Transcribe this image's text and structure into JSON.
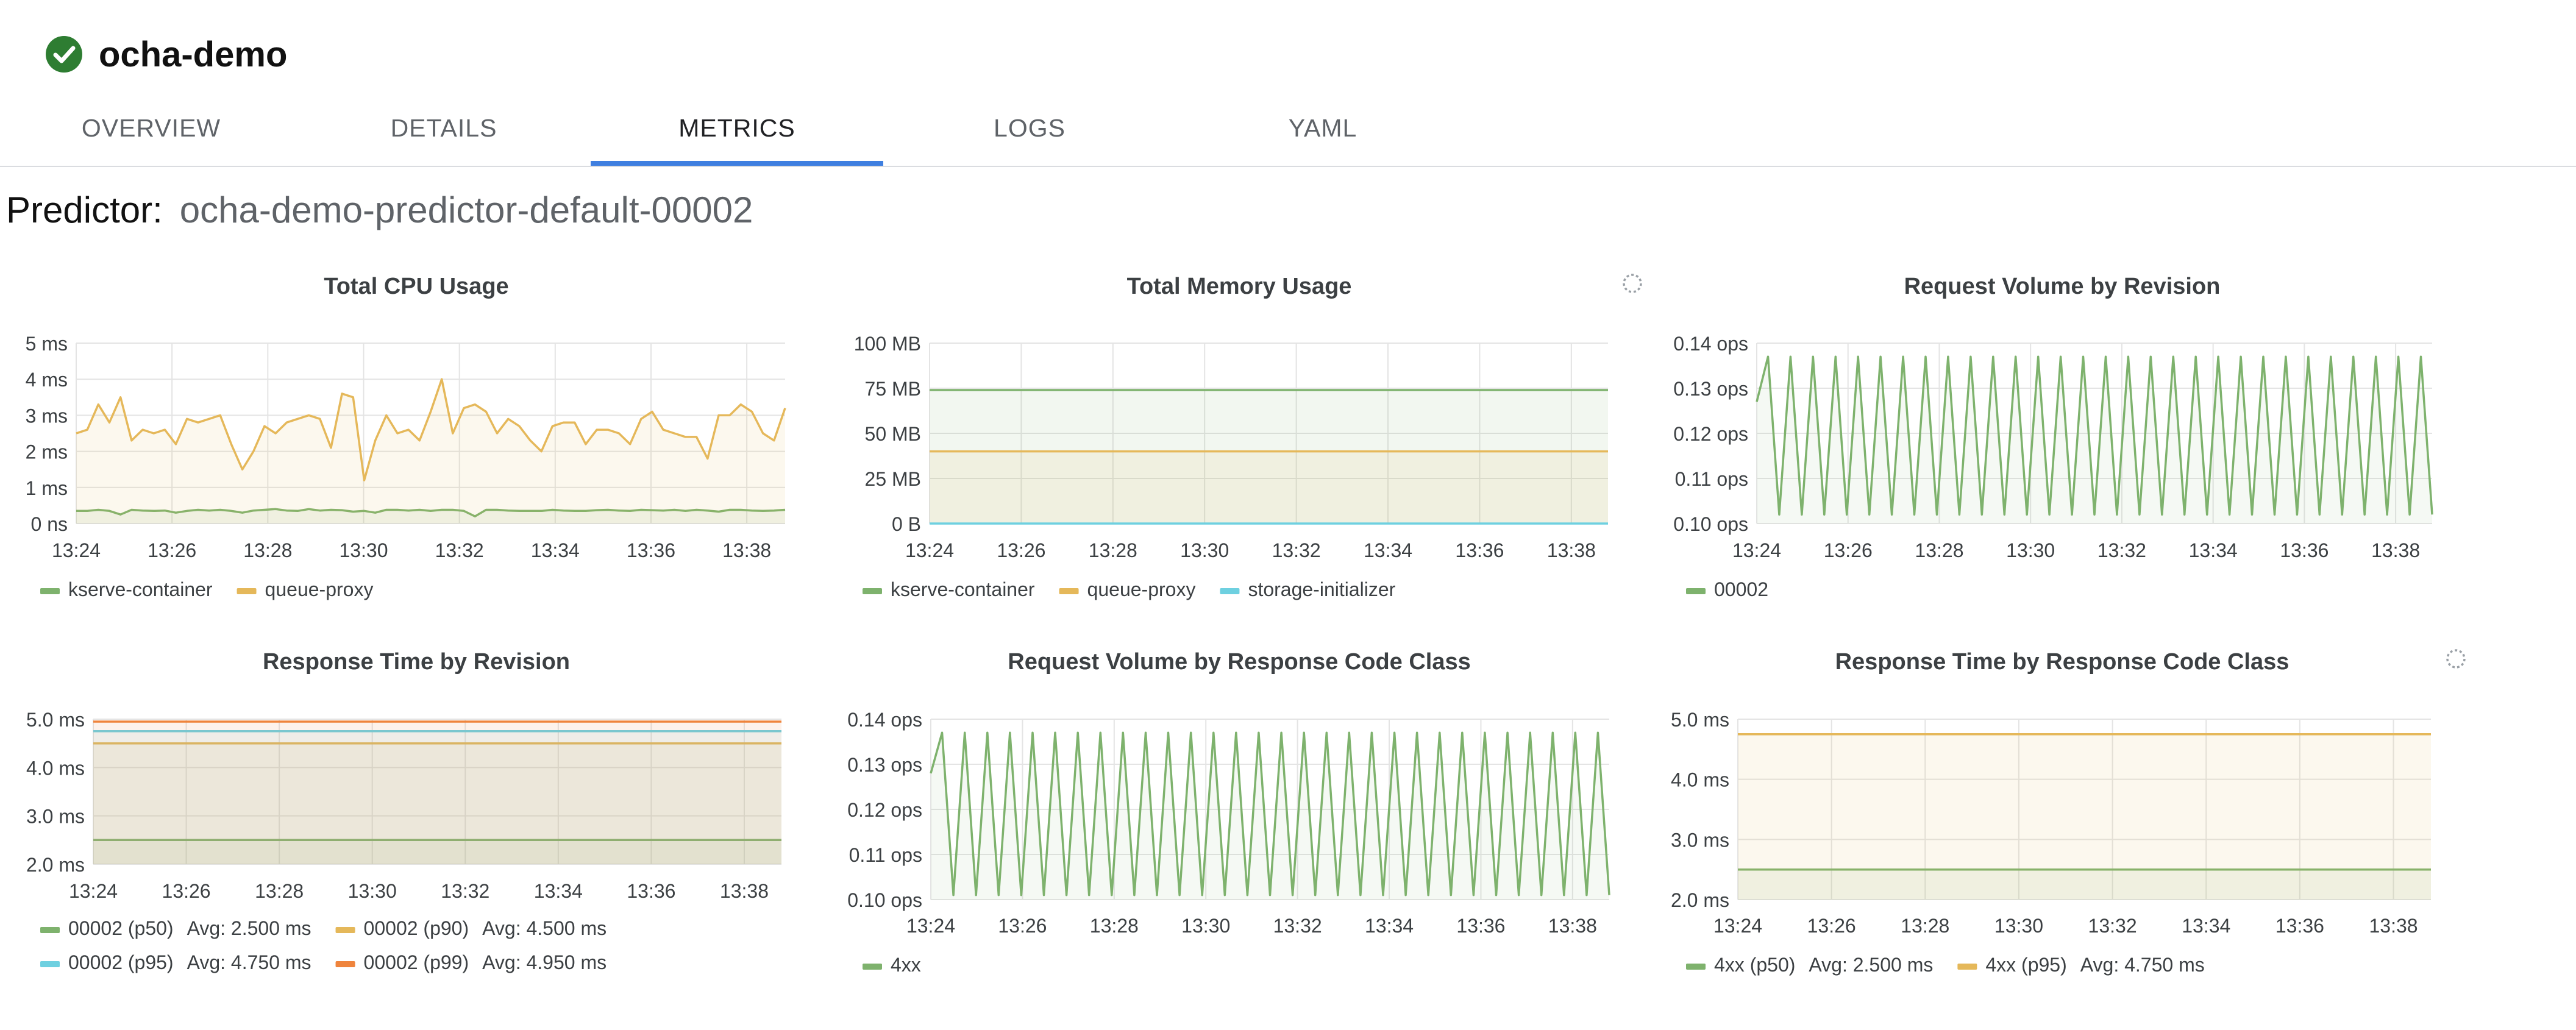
{
  "header": {
    "title": "ocha-demo",
    "status_icon": "check-circle-icon",
    "status_color": "#2e7d32"
  },
  "tabs": [
    {
      "label": "OVERVIEW",
      "active": false
    },
    {
      "label": "DETAILS",
      "active": false
    },
    {
      "label": "METRICS",
      "active": true
    },
    {
      "label": "LOGS",
      "active": false
    },
    {
      "label": "YAML",
      "active": false
    }
  ],
  "predictor": {
    "label": "Predictor:",
    "name": "ocha-demo-predictor-default-00002"
  },
  "colors": {
    "green": "#7eb26d",
    "yellow": "#e5b85a",
    "cyan": "#6ed0e0",
    "orange": "#ef843c",
    "accent": "#3f7fe0"
  },
  "chart_data": [
    {
      "type": "area",
      "title": "Total CPU Usage",
      "x": [
        "13:24",
        "13:26",
        "13:28",
        "13:30",
        "13:32",
        "13:34",
        "13:36",
        "13:38"
      ],
      "y_ticks": [
        "0 ns",
        "1 ms",
        "2 ms",
        "3 ms",
        "4 ms",
        "5 ms"
      ],
      "ylim": [
        0,
        5
      ],
      "xlim": [
        0,
        14.8
      ],
      "series": [
        {
          "name": "kserve-container",
          "color": "#7eb26d",
          "values": [
            0.35,
            0.35,
            0.38,
            0.35,
            0.25,
            0.38,
            0.36,
            0.35,
            0.36,
            0.3,
            0.35,
            0.38,
            0.36,
            0.38,
            0.35,
            0.3,
            0.36,
            0.38,
            0.4,
            0.36,
            0.35,
            0.4,
            0.36,
            0.38,
            0.37,
            0.33,
            0.35,
            0.3,
            0.38,
            0.38,
            0.36,
            0.38,
            0.35,
            0.38,
            0.38,
            0.35,
            0.2,
            0.38,
            0.38,
            0.36,
            0.35,
            0.35,
            0.35,
            0.38,
            0.36,
            0.35,
            0.35,
            0.37,
            0.38,
            0.36,
            0.35,
            0.38,
            0.37,
            0.36,
            0.38,
            0.35,
            0.38,
            0.36,
            0.33,
            0.38,
            0.38,
            0.36,
            0.35,
            0.36,
            0.38
          ]
        },
        {
          "name": "queue-proxy",
          "color": "#e5b85a",
          "values": [
            2.5,
            2.6,
            3.3,
            2.8,
            3.5,
            2.3,
            2.6,
            2.5,
            2.6,
            2.2,
            2.9,
            2.8,
            2.9,
            3.0,
            2.2,
            1.5,
            2.0,
            2.7,
            2.5,
            2.8,
            2.9,
            3.0,
            2.9,
            2.1,
            3.6,
            3.5,
            1.2,
            2.3,
            3.0,
            2.5,
            2.6,
            2.3,
            3.1,
            4.0,
            2.5,
            3.2,
            3.3,
            3.1,
            2.5,
            2.9,
            2.7,
            2.3,
            2.0,
            2.7,
            2.8,
            2.8,
            2.2,
            2.6,
            2.6,
            2.5,
            2.2,
            2.9,
            3.1,
            2.6,
            2.5,
            2.4,
            2.4,
            1.8,
            3.0,
            3.0,
            3.3,
            3.1,
            2.5,
            2.3,
            3.2
          ]
        }
      ]
    },
    {
      "type": "area",
      "title": "Total Memory Usage",
      "x": [
        "13:24",
        "13:26",
        "13:28",
        "13:30",
        "13:32",
        "13:34",
        "13:36",
        "13:38"
      ],
      "y_ticks": [
        "0 B",
        "25 MB",
        "50 MB",
        "75 MB",
        "100 MB"
      ],
      "ylim": [
        0,
        100
      ],
      "xlim": [
        0,
        14.8
      ],
      "series": [
        {
          "name": "kserve-container",
          "color": "#7eb26d",
          "values": [
            74,
            74
          ]
        },
        {
          "name": "queue-proxy",
          "color": "#e5b85a",
          "values": [
            40,
            40
          ]
        },
        {
          "name": "storage-initializer",
          "color": "#6ed0e0",
          "values": [
            0,
            0
          ]
        }
      ]
    },
    {
      "type": "line",
      "title": "Request Volume by Revision",
      "x": [
        "13:24",
        "13:26",
        "13:28",
        "13:30",
        "13:32",
        "13:34",
        "13:36",
        "13:38"
      ],
      "y_ticks": [
        "0.10 ops",
        "0.11 ops",
        "0.12 ops",
        "0.13 ops",
        "0.14 ops"
      ],
      "ylim": [
        0.1,
        0.14
      ],
      "xlim": [
        0,
        14.8
      ],
      "series": [
        {
          "name": "00002",
          "color": "#7eb26d",
          "values": [
            0.127,
            0.137,
            0.102,
            0.137,
            0.102,
            0.137,
            0.102,
            0.137,
            0.102,
            0.137,
            0.102,
            0.137,
            0.102,
            0.137,
            0.102,
            0.137,
            0.102,
            0.137,
            0.102,
            0.137,
            0.102,
            0.137,
            0.102,
            0.137,
            0.102,
            0.137,
            0.102,
            0.137,
            0.102,
            0.137,
            0.102,
            0.137,
            0.102,
            0.137,
            0.102,
            0.137,
            0.102,
            0.137,
            0.102,
            0.137,
            0.102,
            0.137,
            0.102,
            0.137,
            0.102,
            0.137,
            0.102,
            0.137,
            0.102,
            0.137,
            0.102,
            0.137,
            0.102,
            0.137,
            0.102,
            0.137,
            0.102,
            0.137,
            0.102,
            0.137,
            0.102
          ]
        }
      ]
    },
    {
      "type": "area",
      "title": "Response Time by Revision",
      "x": [
        "13:24",
        "13:26",
        "13:28",
        "13:30",
        "13:32",
        "13:34",
        "13:36",
        "13:38"
      ],
      "y_ticks": [
        "2.0 ms",
        "3.0 ms",
        "4.0 ms",
        "5.0 ms"
      ],
      "ylim": [
        2,
        5
      ],
      "xlim": [
        0,
        14.8
      ],
      "series": [
        {
          "name": "00002 (p50)",
          "avg": "Avg: 2.500 ms",
          "color": "#7eb26d",
          "values": [
            2.5,
            2.5
          ]
        },
        {
          "name": "00002 (p90)",
          "avg": "Avg: 4.500 ms",
          "color": "#e5b85a",
          "values": [
            4.5,
            4.5
          ]
        },
        {
          "name": "00002 (p95)",
          "avg": "Avg: 4.750 ms",
          "color": "#6ed0e0",
          "values": [
            4.75,
            4.75
          ]
        },
        {
          "name": "00002 (p99)",
          "avg": "Avg: 4.950 ms",
          "color": "#ef843c",
          "values": [
            4.95,
            4.95
          ]
        }
      ]
    },
    {
      "type": "line",
      "title": "Request Volume by Response Code Class",
      "x": [
        "13:24",
        "13:26",
        "13:28",
        "13:30",
        "13:32",
        "13:34",
        "13:36",
        "13:38"
      ],
      "y_ticks": [
        "0.10 ops",
        "0.11 ops",
        "0.12 ops",
        "0.13 ops",
        "0.14 ops"
      ],
      "ylim": [
        0.1,
        0.14
      ],
      "xlim": [
        0,
        14.8
      ],
      "series": [
        {
          "name": "4xx",
          "color": "#7eb26d",
          "values": [
            0.128,
            0.137,
            0.101,
            0.137,
            0.101,
            0.137,
            0.101,
            0.137,
            0.101,
            0.137,
            0.101,
            0.137,
            0.101,
            0.137,
            0.101,
            0.137,
            0.101,
            0.137,
            0.101,
            0.137,
            0.101,
            0.137,
            0.101,
            0.137,
            0.101,
            0.137,
            0.101,
            0.137,
            0.101,
            0.137,
            0.101,
            0.137,
            0.101,
            0.137,
            0.101,
            0.137,
            0.101,
            0.137,
            0.101,
            0.137,
            0.101,
            0.137,
            0.101,
            0.137,
            0.101,
            0.137,
            0.101,
            0.137,
            0.101,
            0.137,
            0.101,
            0.137,
            0.101,
            0.137,
            0.101,
            0.137,
            0.101,
            0.137,
            0.101,
            0.137,
            0.101
          ]
        }
      ]
    },
    {
      "type": "area",
      "title": "Response Time by Response Code Class",
      "x": [
        "13:24",
        "13:26",
        "13:28",
        "13:30",
        "13:32",
        "13:34",
        "13:36",
        "13:38"
      ],
      "y_ticks": [
        "2.0 ms",
        "3.0 ms",
        "4.0 ms",
        "5.0 ms"
      ],
      "ylim": [
        2,
        5
      ],
      "xlim": [
        0,
        14.8
      ],
      "series": [
        {
          "name": "4xx (p50)",
          "avg": "Avg: 2.500 ms",
          "color": "#7eb26d",
          "values": [
            2.5,
            2.5
          ]
        },
        {
          "name": "4xx (p95)",
          "avg": "Avg: 4.750 ms",
          "color": "#e5b85a",
          "values": [
            4.75,
            4.75
          ]
        }
      ]
    }
  ]
}
